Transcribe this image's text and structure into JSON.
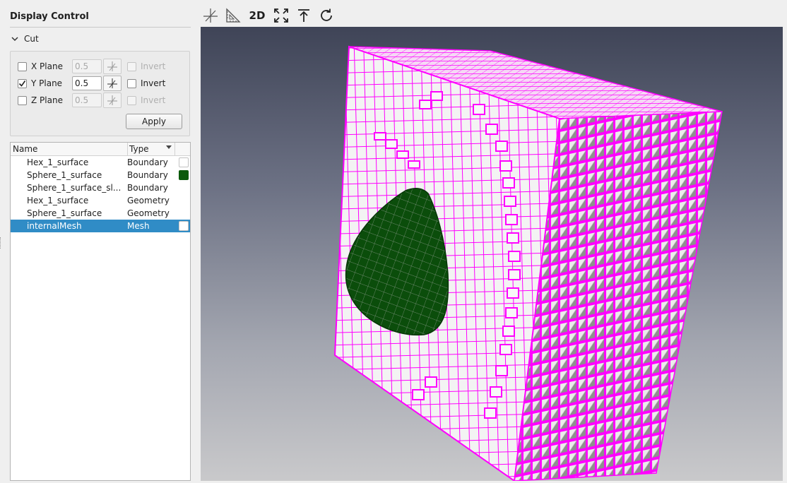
{
  "panel": {
    "title": "Display Control"
  },
  "cut": {
    "section_label": "Cut",
    "planes": [
      {
        "label": "X Plane",
        "checked": false,
        "value": "0.5",
        "enabled": false,
        "invert_label": "Invert",
        "invert_checked": false
      },
      {
        "label": "Y Plane",
        "checked": true,
        "value": "0.5",
        "enabled": true,
        "invert_label": "Invert",
        "invert_checked": false
      },
      {
        "label": "Z Plane",
        "checked": false,
        "value": "0.5",
        "enabled": false,
        "invert_label": "Invert",
        "invert_checked": false
      }
    ],
    "apply_label": "Apply"
  },
  "tree": {
    "columns": {
      "name": "Name",
      "type": "Type"
    },
    "rows": [
      {
        "name": "Hex_1_surface",
        "type": "Boundary",
        "color": "#ffffff"
      },
      {
        "name": "Sphere_1_surface",
        "type": "Boundary",
        "color": "#0b5a0b"
      },
      {
        "name": "Sphere_1_surface_sl...",
        "type": "Boundary",
        "color": null
      },
      {
        "name": "Hex_1_surface",
        "type": "Geometry",
        "color": null
      },
      {
        "name": "Sphere_1_surface",
        "type": "Geometry",
        "color": null
      },
      {
        "name": "internalMesh",
        "type": "Mesh",
        "color": "#ffffff",
        "selected": true
      }
    ]
  },
  "toolbar": {
    "buttons": [
      {
        "icon": "axes-icon"
      },
      {
        "icon": "ruler-triangle-icon"
      },
      {
        "label": "2D"
      },
      {
        "icon": "fit-view-icon"
      },
      {
        "icon": "view-up-icon"
      },
      {
        "icon": "reset-rotate-icon"
      }
    ]
  },
  "viewport": {
    "mesh_edge_color": "#ff00ff",
    "face_color": "#f2f2f2",
    "sphere_color": "#0b4d0b",
    "background_top": "#3f4457",
    "background_bottom": "#c9c9cb"
  }
}
